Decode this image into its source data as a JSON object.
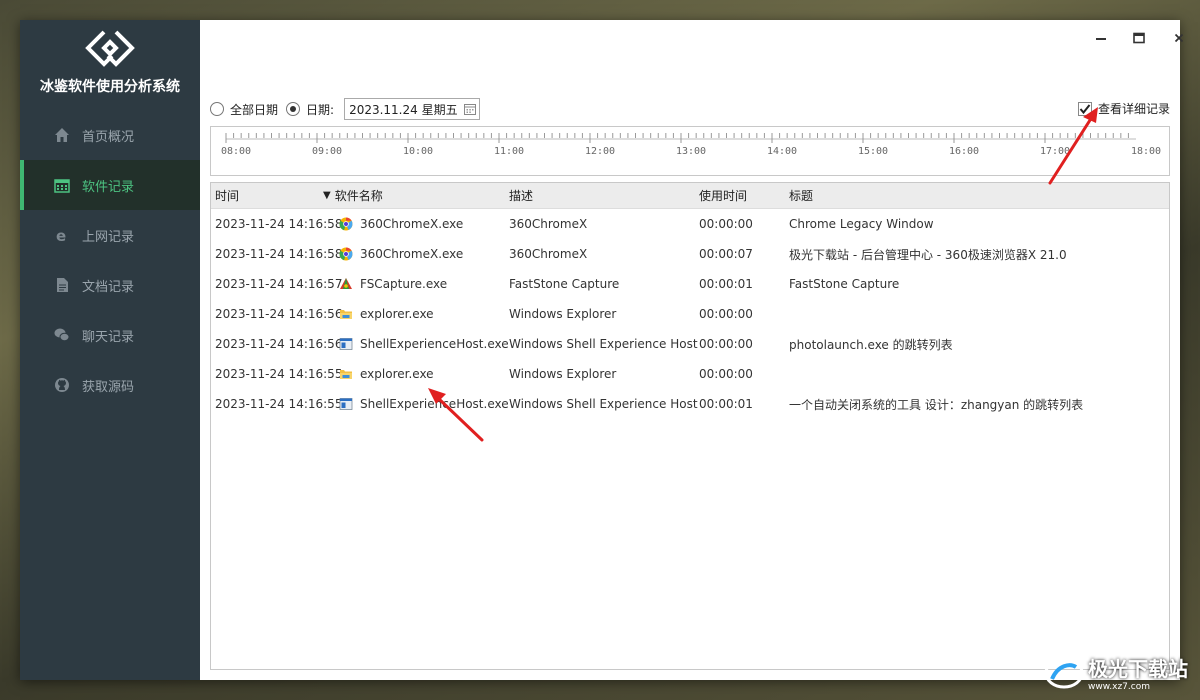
{
  "app": {
    "title": "冰鉴软件使用分析系统"
  },
  "sidebar": {
    "items": [
      {
        "label": "首页概况",
        "icon": "home-icon"
      },
      {
        "label": "软件记录",
        "icon": "calendar-icon",
        "active": true
      },
      {
        "label": "上网记录",
        "icon": "ie-icon"
      },
      {
        "label": "文档记录",
        "icon": "document-icon"
      },
      {
        "label": "聊天记录",
        "icon": "wechat-icon"
      },
      {
        "label": "获取源码",
        "icon": "github-icon"
      }
    ]
  },
  "window_controls": {
    "minimize": "–",
    "maximize": "□",
    "close": "×"
  },
  "filter": {
    "all_dates_label": "全部日期",
    "date_label": "日期:",
    "date_value": "2023.11.24 星期五",
    "detail_label": "查看详细记录",
    "detail_checked": true
  },
  "timeline": {
    "ticks": [
      "08:00",
      "09:00",
      "10:00",
      "11:00",
      "12:00",
      "13:00",
      "14:00",
      "15:00",
      "16:00",
      "17:00",
      "18:00"
    ]
  },
  "table": {
    "columns": [
      "时间",
      "软件名称",
      "描述",
      "使用时间",
      "标题"
    ],
    "rows": [
      {
        "time": "2023-11-24 14:16:58",
        "name": "360ChromeX.exe",
        "icon": "chrome-icon",
        "desc": "360ChromeX",
        "duration": "00:00:00",
        "title": "Chrome Legacy Window"
      },
      {
        "time": "2023-11-24 14:16:58",
        "name": "360ChromeX.exe",
        "icon": "chrome-icon",
        "desc": "360ChromeX",
        "duration": "00:00:07",
        "title": "极光下载站 - 后台管理中心 - 360极速浏览器X 21.0"
      },
      {
        "time": "2023-11-24 14:16:57",
        "name": "FSCapture.exe",
        "icon": "faststone-icon",
        "desc": "FastStone Capture",
        "duration": "00:00:01",
        "title": "FastStone Capture"
      },
      {
        "time": "2023-11-24 14:16:56",
        "name": "explorer.exe",
        "icon": "folder-icon",
        "desc": "Windows Explorer",
        "duration": "00:00:00",
        "title": ""
      },
      {
        "time": "2023-11-24 14:16:56",
        "name": "ShellExperienceHost.exe",
        "icon": "window-icon",
        "desc": "Windows Shell Experience Host",
        "duration": "00:00:00",
        "title": "photolaunch.exe 的跳转列表"
      },
      {
        "time": "2023-11-24 14:16:55",
        "name": "explorer.exe",
        "icon": "folder-icon",
        "desc": "Windows Explorer",
        "duration": "00:00:00",
        "title": ""
      },
      {
        "time": "2023-11-24 14:16:55",
        "name": "ShellExperienceHost.exe",
        "icon": "window-icon",
        "desc": "Windows Shell Experience Host",
        "duration": "00:00:01",
        "title": "一个自动关闭系统的工具  设计：zhangyan 的跳转列表"
      }
    ]
  },
  "watermark": {
    "text": "极光下载站",
    "url": "www.xz7.com"
  },
  "colors": {
    "sidebar_bg": "#2d3a42",
    "accent_green": "#3fb872",
    "arrow_red": "#e02020"
  }
}
